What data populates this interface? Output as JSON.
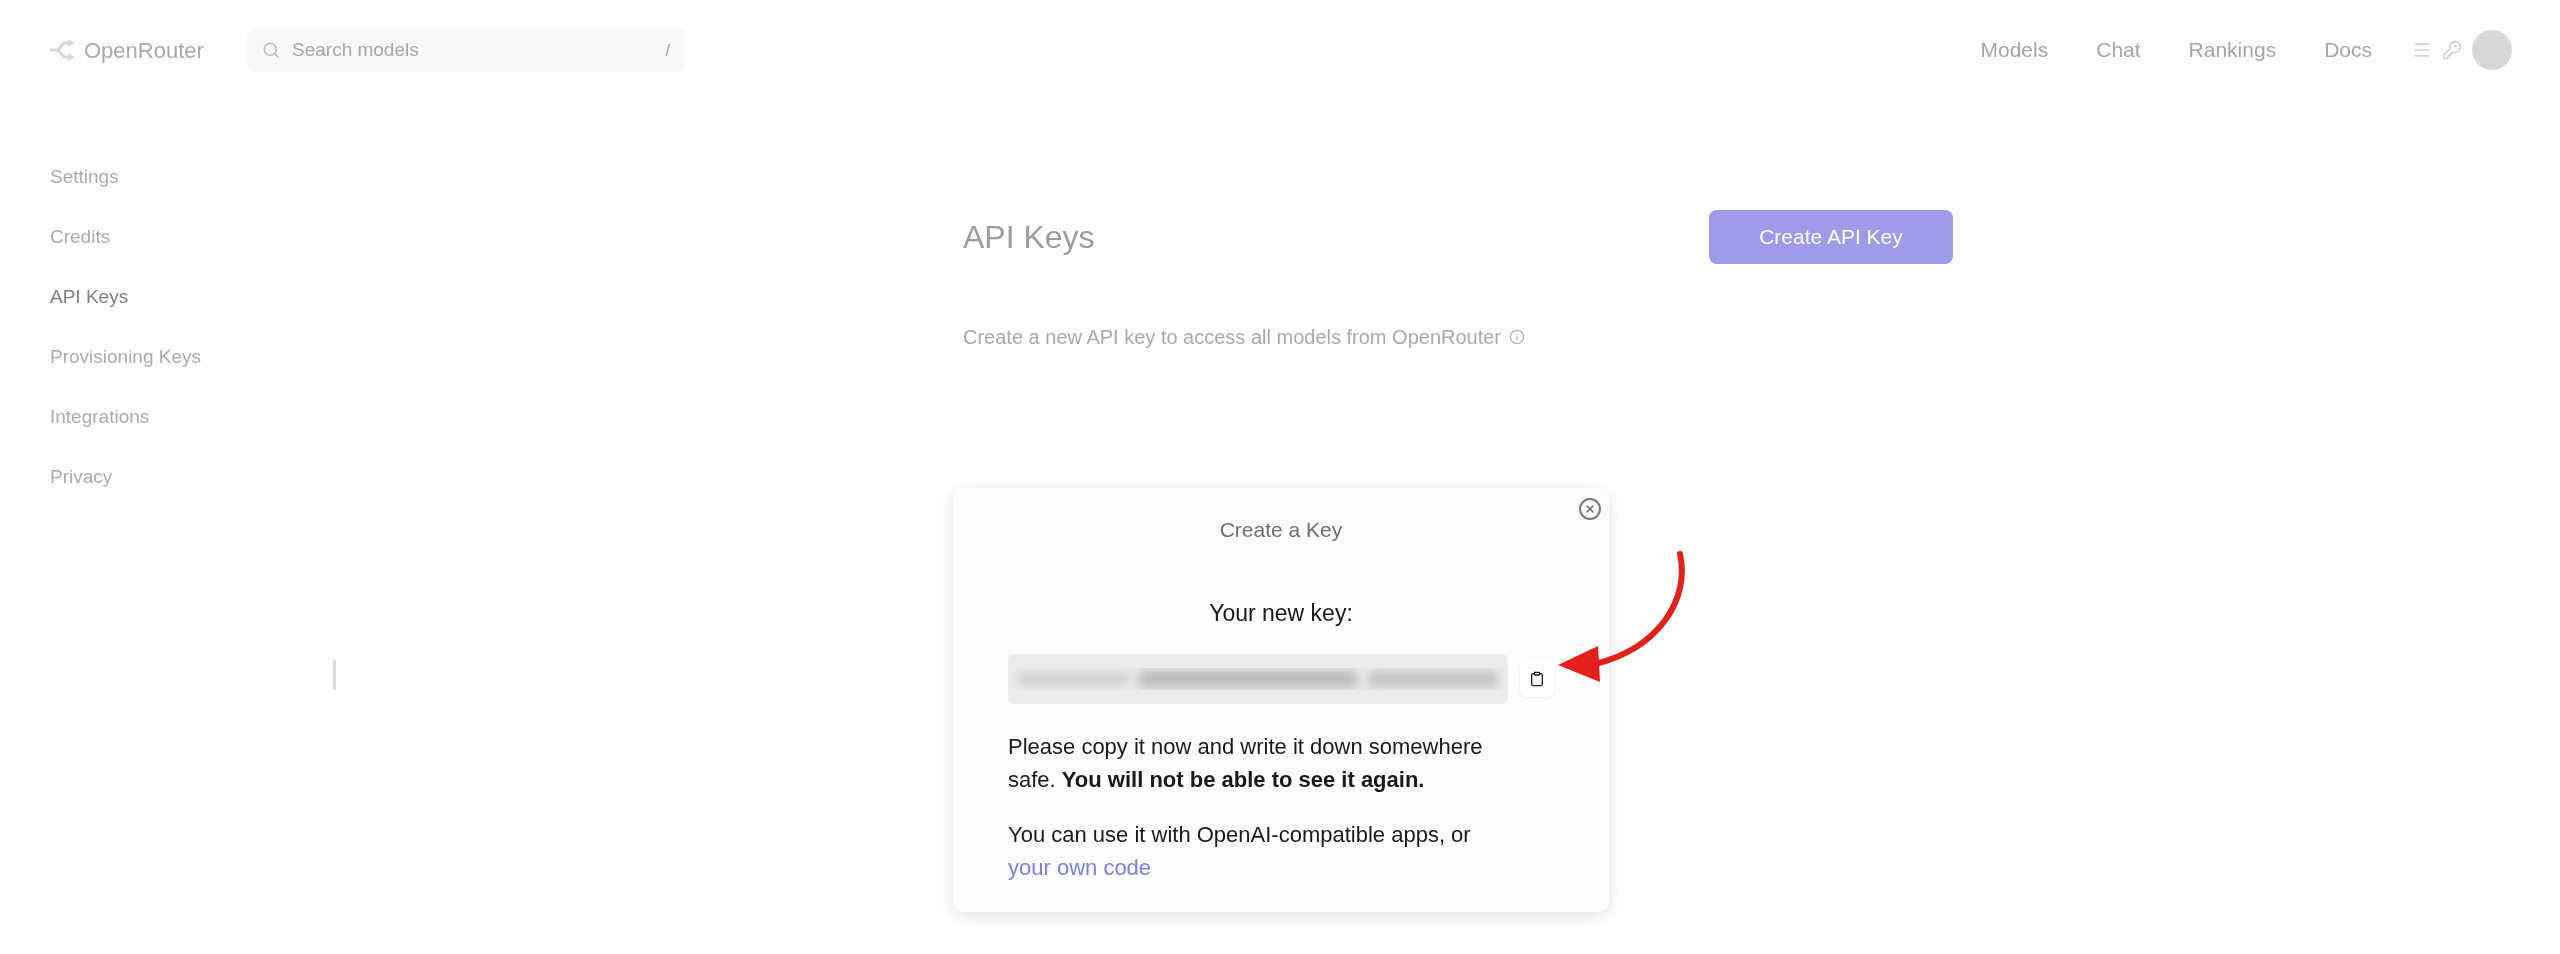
{
  "header": {
    "brand": "OpenRouter",
    "search": {
      "placeholder": "Search models",
      "shortcut": "/"
    },
    "nav": [
      "Models",
      "Chat",
      "Rankings",
      "Docs"
    ]
  },
  "sidebar": {
    "items": [
      {
        "label": "Settings",
        "selected": false
      },
      {
        "label": "Credits",
        "selected": false
      },
      {
        "label": "API Keys",
        "selected": true
      },
      {
        "label": "Provisioning Keys",
        "selected": false
      },
      {
        "label": "Integrations",
        "selected": false
      },
      {
        "label": "Privacy",
        "selected": false
      }
    ]
  },
  "page": {
    "title": "API Keys",
    "create_button": "Create API Key",
    "description": "Create a new API key to access all models from OpenRouter"
  },
  "dialog": {
    "title": "Create a Key",
    "key_label": "Your new key:",
    "warning": "Please copy it now and write it down somewhere safe. **You will not be able to see it again.**",
    "usage": "You can use it with OpenAI-compatible apps, or",
    "usage_link": "your own code"
  }
}
